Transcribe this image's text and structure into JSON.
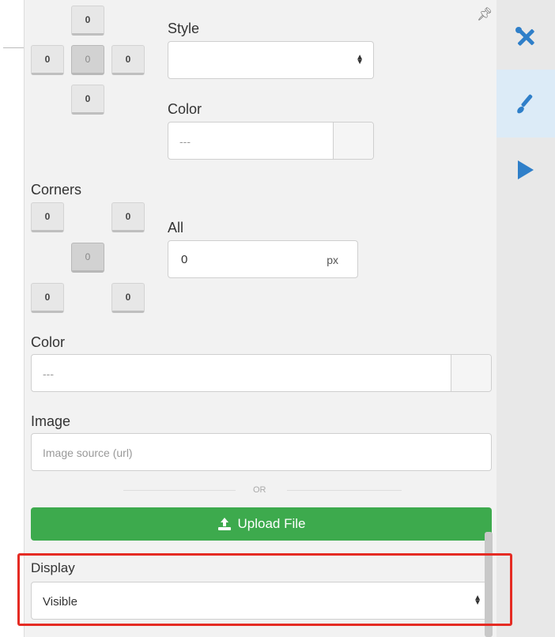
{
  "panel": {
    "border": {
      "top": "0",
      "left": "0",
      "center": "0",
      "right": "0",
      "bottom": "0",
      "style_label": "Style",
      "style_value": "",
      "color_label": "Color",
      "color_placeholder": "---"
    },
    "corners": {
      "label": "Corners",
      "top_left": "0",
      "top_right": "0",
      "center": "0",
      "bottom_left": "0",
      "bottom_right": "0",
      "all_label": "All",
      "all_value": "0",
      "all_unit": "px"
    },
    "background": {
      "color_label": "Color",
      "color_placeholder": "---",
      "image_label": "Image",
      "image_placeholder": "Image source (url)",
      "or_text": "OR",
      "upload_label": "Upload File"
    },
    "display": {
      "label": "Display",
      "value": "Visible"
    }
  },
  "sidebar": {
    "items": [
      {
        "icon": "tools-icon",
        "active": false
      },
      {
        "icon": "brush-icon",
        "active": true
      },
      {
        "icon": "play-icon",
        "active": false
      }
    ]
  },
  "colors": {
    "accent_blue": "#2f7fc9",
    "upload_green": "#3daa4d",
    "highlight_red": "#e52b23"
  }
}
